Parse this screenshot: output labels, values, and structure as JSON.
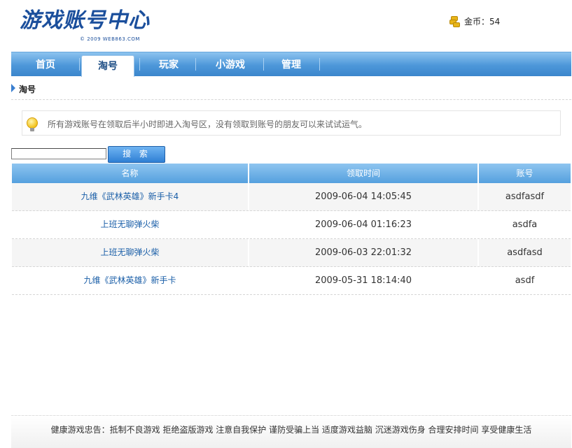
{
  "logo": {
    "title": "游戏账号中心",
    "subtitle": "© 2009 WEB863.COM"
  },
  "coins": {
    "icon": "coins-icon",
    "label": "金币：54"
  },
  "nav": {
    "tabs": [
      "首页",
      "淘号",
      "玩家",
      "小游戏",
      "管理"
    ],
    "active": "淘号"
  },
  "section": {
    "title": "淘号"
  },
  "notice": {
    "icon": "lightbulb-icon",
    "text": "所有游戏账号在领取后半小时即进入淘号区，没有领取到账号的朋友可以来试试运气。"
  },
  "search": {
    "value": "",
    "button_label": "搜 索"
  },
  "table": {
    "headers": [
      "名称",
      "领取时间",
      "账号"
    ],
    "rows": [
      {
        "name": "九维《武林英雄》新手卡4",
        "time": "2009-06-04 14:05:45",
        "account": "asdfasdf"
      },
      {
        "name": "上班无聊弹火柴",
        "time": "2009-06-04 01:16:23",
        "account": "asdfa"
      },
      {
        "name": "上班无聊弹火柴",
        "time": "2009-06-03 22:01:32",
        "account": "asdfasd"
      },
      {
        "name": "九维《武林英雄》新手卡",
        "time": "2009-05-31 18:14:40",
        "account": "asdf"
      }
    ]
  },
  "footer": {
    "text": "健康游戏忠告：抵制不良游戏 拒绝盗版游戏 注意自我保护 谨防受骗上当 适度游戏益脑 沉迷游戏伤身 合理安排时间 享受健康生活"
  },
  "colors": {
    "nav_blue": "#4d97d9",
    "link_blue": "#1b5fa8",
    "logo_blue": "#1b4f9c"
  }
}
